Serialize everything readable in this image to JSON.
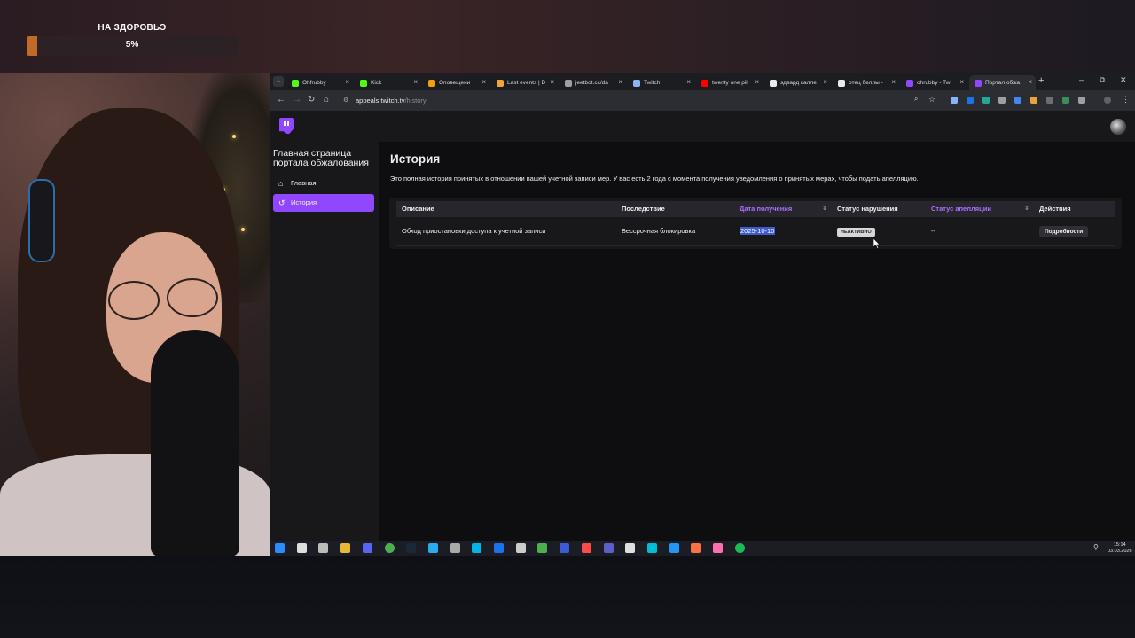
{
  "overlay": {
    "health_title": "НА ЗДОРОВЬЭ",
    "health_percent": "5%",
    "health_value": 5,
    "health_color": "#c46a28"
  },
  "browser": {
    "tabs": [
      {
        "label": "Ohfrubby",
        "icon": "kick-icon",
        "color": "#53fc18"
      },
      {
        "label": "Kick",
        "icon": "kick-icon",
        "color": "#53fc18"
      },
      {
        "label": "Оповещени",
        "icon": "alert-icon",
        "color": "#f59e0b"
      },
      {
        "label": "Last events | D",
        "icon": "da-icon",
        "color": "#f2a33a"
      },
      {
        "label": "jeetbot.cc/da",
        "icon": "page-icon",
        "color": "#9aa0a6"
      },
      {
        "label": "Twitch",
        "icon": "shield-icon",
        "color": "#8ab4f8"
      },
      {
        "label": "twenty one pil",
        "icon": "youtube-icon",
        "color": "#ff0000"
      },
      {
        "label": "эдвард калле",
        "icon": "google-icon",
        "color": "#e8eaed"
      },
      {
        "label": "отец беллы -",
        "icon": "google-icon",
        "color": "#e8eaed"
      },
      {
        "label": "ohrubby - Twi",
        "icon": "twitch-icon",
        "color": "#9147ff"
      },
      {
        "label": "Портал обжа",
        "icon": "twitch-icon",
        "color": "#9147ff"
      }
    ],
    "url_host": "appeals.twitch.tv",
    "url_path": "/history"
  },
  "portal": {
    "sidebar_title": "Главная страница портала обжалования",
    "nav": [
      {
        "label": "Главная",
        "icon": "home-icon"
      },
      {
        "label": "История",
        "icon": "history-icon"
      }
    ],
    "heading": "История",
    "description": "Это полная история принятых в отношении вашей учетной записи мер. У вас есть 2 года с момента получения уведомления о принятых мерах, чтобы подать апелляцию.",
    "table": {
      "headers": [
        "Описание",
        "Последствие",
        "Дата получения",
        "Статус нарушения",
        "Статус апелляции",
        "Действия"
      ],
      "rows": [
        {
          "description": "Обход приостановки доступа к учетной записи",
          "consequence": "Бессрочная блокировка",
          "date": "2025-10-10",
          "violation_status": "НЕАКТИВНО",
          "appeal_status": "--",
          "action": "Подробности"
        }
      ]
    },
    "accent_color": "#9147ff"
  },
  "taskbar": {
    "time": "15:14",
    "date": "03.03.2026"
  }
}
